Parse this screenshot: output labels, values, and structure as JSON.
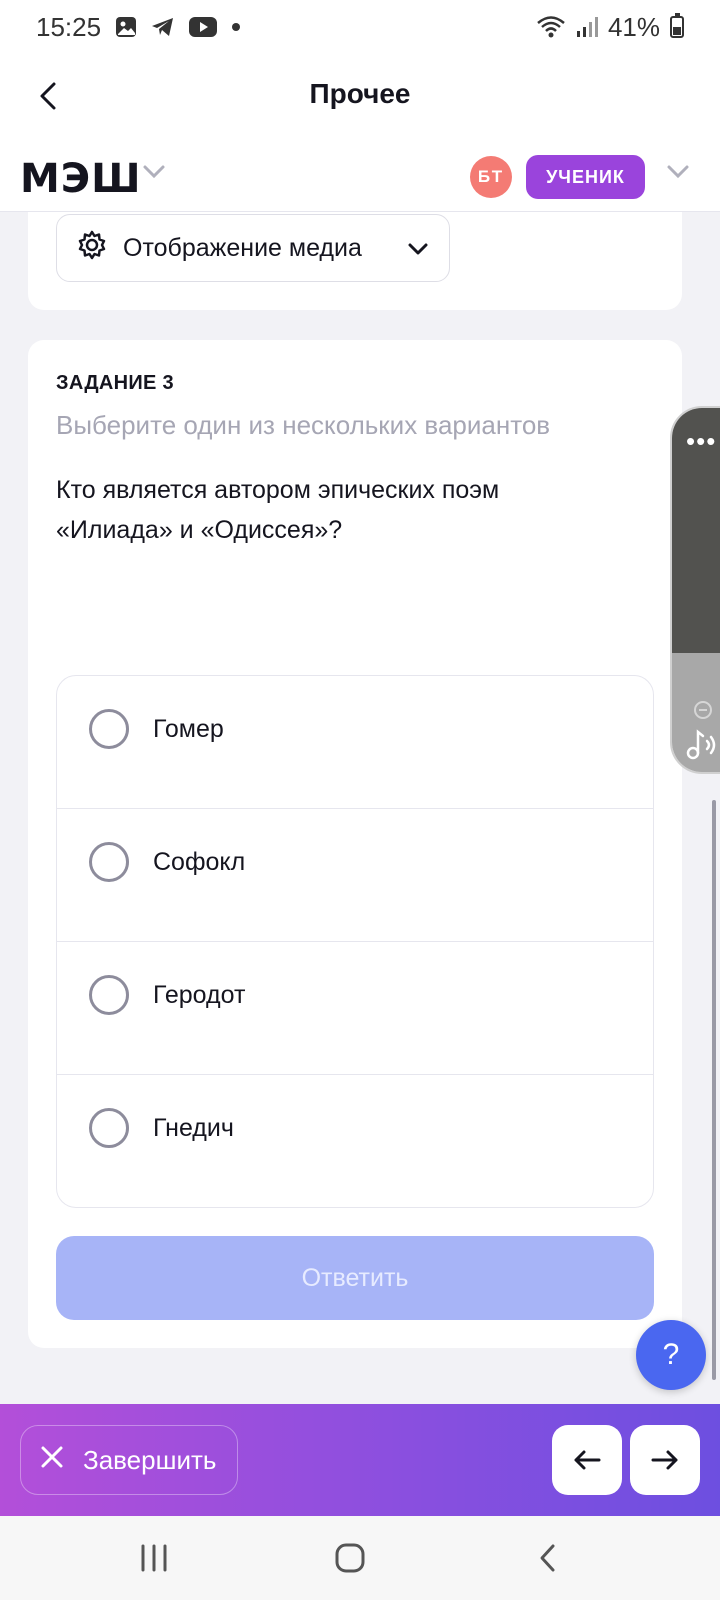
{
  "status_bar": {
    "time": "15:25",
    "notif_icons": [
      "gallery-icon",
      "telegram-icon",
      "youtube-icon",
      "dot-icon"
    ],
    "battery": "41%"
  },
  "header": {
    "title": "Прочее"
  },
  "app_bar": {
    "logo": "МЭШ",
    "avatar_initials": "БТ",
    "role": "УЧЕНИК",
    "colors": {
      "avatar": "#f47b74",
      "role_badge": "#9a44dc"
    }
  },
  "media_settings": {
    "label": "Отображение медиа"
  },
  "task": {
    "heading": "ЗАДАНИЕ 3",
    "instruction": "Выберите один из нескольких вариантов",
    "question": "Кто является автором эпических поэм «Илиада» и «Одиссея»?",
    "options": [
      "Гомер",
      "Софокл",
      "Геродот",
      "Гнедич"
    ],
    "submit_label": "Ответить"
  },
  "help": {
    "label": "?"
  },
  "bottom_bar": {
    "finish_label": "Завершить",
    "colors": {
      "gradient_start": "#b34fd9",
      "gradient_end": "#6d4fe0"
    }
  }
}
